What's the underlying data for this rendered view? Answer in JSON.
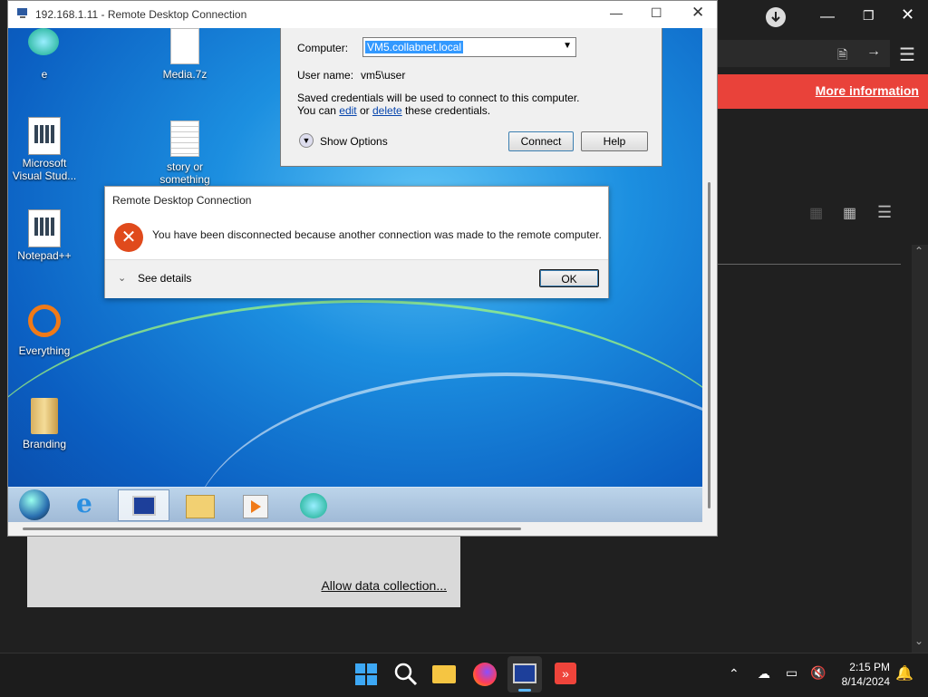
{
  "host": {
    "banner_link": "More information",
    "panel_link": "Allow data collection..."
  },
  "rdp": {
    "title": "192.168.1.11 - Remote Desktop Connection",
    "desktop_icons": [
      {
        "label": "e",
        "icon": "app-icon"
      },
      {
        "label": "Media.7z",
        "icon": "file-icon"
      },
      {
        "label": "Microsoft Visual Stud...",
        "icon": "visual-studio-icon"
      },
      {
        "label": "story or something",
        "icon": "text-file-icon"
      },
      {
        "label": "Notepad++",
        "icon": "notepadpp-icon"
      },
      {
        "label": "Everything",
        "icon": "everything-icon"
      },
      {
        "label": "Branding",
        "icon": "folder-icon"
      }
    ]
  },
  "credentials": {
    "computer_label": "Computer:",
    "computer_value": "VM5.collabnet.local",
    "username_label": "User name:",
    "username_value": "vm5\\user",
    "note_line1": "Saved credentials will be used to connect to this computer.",
    "note_you_can": "You can",
    "edit_link": "edit",
    "or_text": "or",
    "delete_link": "delete",
    "note_end": "these credentials.",
    "show_options": "Show Options",
    "connect_button": "Connect",
    "help_button": "Help"
  },
  "error_dialog": {
    "title": "Remote Desktop Connection",
    "message": "You have been disconnected because another connection was made to the remote computer.",
    "see_details": "See details",
    "ok_button": "OK"
  },
  "tray": {
    "time": "2:15 PM",
    "date": "8/14/2024"
  },
  "colors": {
    "banner": "#e9423a",
    "error_icon": "#e04a1c",
    "w7_desktop": "#1c8fe0"
  }
}
